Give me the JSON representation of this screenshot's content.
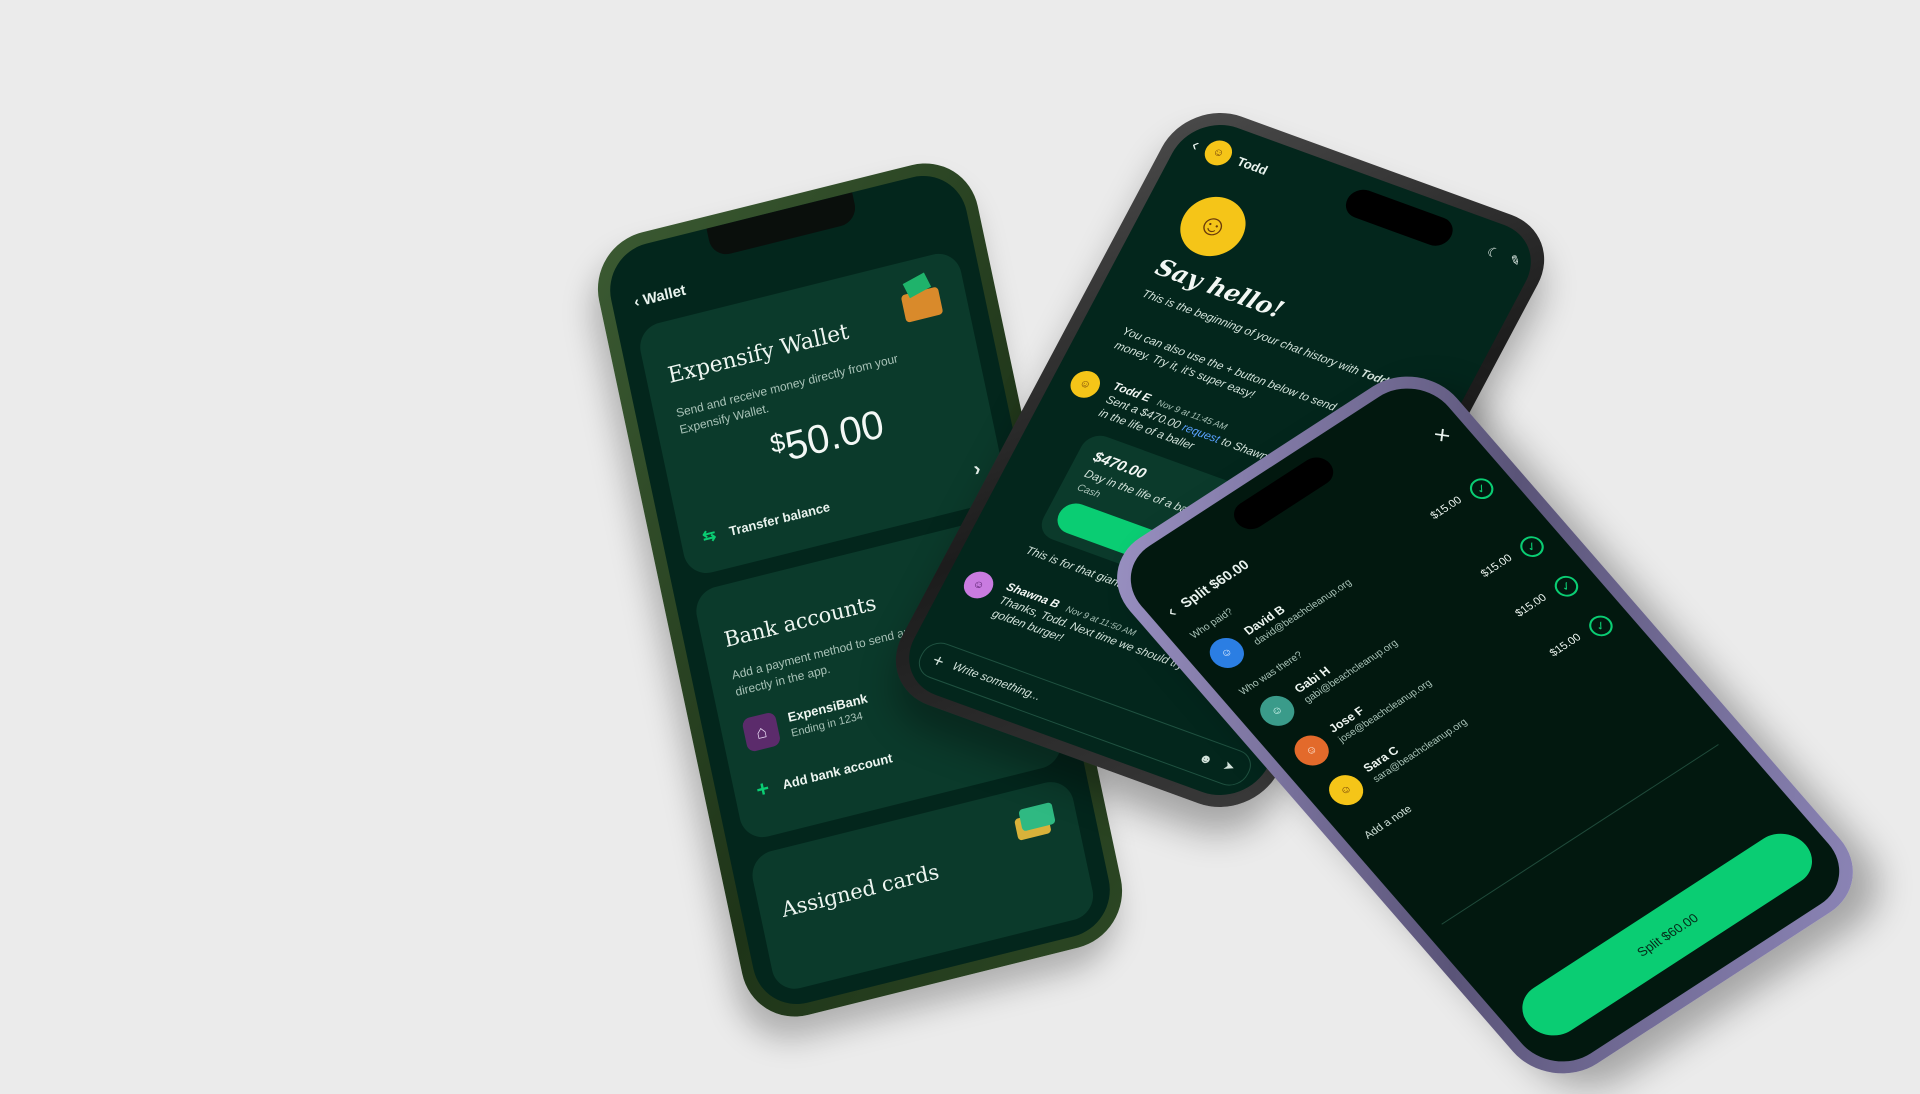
{
  "wallet_phone": {
    "back_label": "Wallet",
    "wallet_card": {
      "title": "Expensify Wallet",
      "description": "Send and receive money directly from your Expensify Wallet.",
      "currency": "$",
      "balance": "50.00",
      "transfer_label": "Transfer balance"
    },
    "bank_card": {
      "title": "Bank accounts",
      "description": "Add a payment method to send and re payments directly in the app.",
      "bank_name": "ExpensiBank",
      "bank_sub": "Ending in 1234",
      "add_label": "Add bank account"
    },
    "cards_card": {
      "title": "Assigned cards"
    }
  },
  "chat_phone": {
    "header_name": "Todd",
    "greeting": "Say hello!",
    "intro_1": "This is the beginning of your chat history with",
    "intro_name": "Todd T",
    "intro_2": "You can also use the + button below to send or request money. Try it, it's super easy!",
    "msg1": {
      "sender": "Todd E",
      "time": "Nov 9 at 11:45 AM",
      "text_before": "Sent a $470.00",
      "link": "request",
      "text_after": "to Shawna B for Day in the life of a baller"
    },
    "request_card": {
      "amount": "$470.00",
      "title": "Day in the life of a baller",
      "method": "Cash",
      "button": "Review & Pay"
    },
    "note": "This is for that giant seafood tower at lunch today!",
    "msg2": {
      "sender": "Shawna B",
      "time": "Nov 9 at 11:50 AM",
      "text": "Thanks, Todd. Next time we should try the golden burger!"
    },
    "composer_placeholder": "Write something..."
  },
  "split_phone": {
    "title": "Split $60.00",
    "who_paid": "Who paid?",
    "payer": {
      "name": "David B",
      "email": "david@beachcleanup.org"
    },
    "who_was_there": "Who was there?",
    "participants": [
      {
        "name": "Gabi H",
        "email": "gabi@beachcleanup.org",
        "amount": "$15.00"
      },
      {
        "name": "Jose F",
        "email": "jose@beachcleanup.org",
        "amount": "$15.00"
      },
      {
        "name": "Sara C",
        "email": "sara@beachcleanup.org",
        "amount": "$15.00"
      }
    ],
    "payer_amount": "$15.00",
    "note_placeholder": "Add a note",
    "split_button": "Split $60.00"
  },
  "colors": {
    "background": "#ebebeb",
    "screen": "#03261c",
    "accent_green": "#0acd73",
    "link_blue": "#5aa2ff"
  }
}
